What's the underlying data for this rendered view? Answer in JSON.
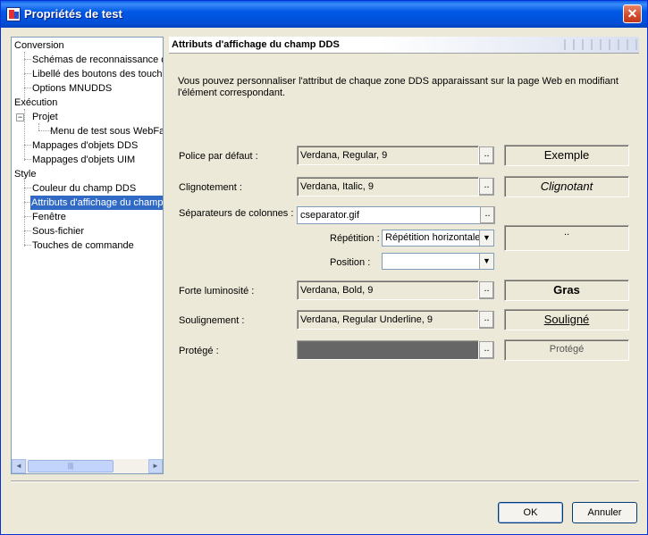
{
  "window": {
    "title": "Propriétés de test",
    "close_label": "✕"
  },
  "tree": {
    "items": [
      {
        "label": "Conversion"
      },
      {
        "label": "Schémas de reconnaissance d"
      },
      {
        "label": "Libellé des boutons des touche"
      },
      {
        "label": "Options MNUDDS"
      },
      {
        "label": "Exécution"
      },
      {
        "label": "Projet"
      },
      {
        "label": "Menu de test sous WebFac"
      },
      {
        "label": "Mappages d'objets DDS"
      },
      {
        "label": "Mappages d'objets UIM"
      },
      {
        "label": "Style"
      },
      {
        "label": "Couleur du champ DDS"
      },
      {
        "label": "Attributs d'affichage du champ"
      },
      {
        "label": "Fenêtre"
      },
      {
        "label": "Sous-fichier"
      },
      {
        "label": "Touches de commande"
      }
    ],
    "expander_label": "−",
    "scroll_left": "◄",
    "scroll_right": "►",
    "scroll_grip": "|||"
  },
  "panel": {
    "title": "Attributs d'affichage du champ DDS",
    "description": "Vous pouvez personnaliser l'attribut de chaque zone DDS apparaissant sur la page Web en modifiant l'élément correspondant."
  },
  "rows": {
    "default_font": {
      "label": "Police par défaut :",
      "value": "Verdana, Regular, 9",
      "sample": "Exemple"
    },
    "blink": {
      "label": "Clignotement :",
      "value": "Verdana, Italic, 9",
      "sample": "Clignotant"
    },
    "separators": {
      "label": "Séparateurs de colonnes :",
      "value": "cseparator.gif",
      "repetition_label": "Répétition :",
      "repetition_value": "Répétition horizontale",
      "position_label": "Position :",
      "position_value": "",
      "preview": ".."
    },
    "highlight": {
      "label": "Forte luminosité :",
      "value": "Verdana, Bold, 9",
      "sample": "Gras"
    },
    "underline": {
      "label": "Soulignement :",
      "value": "Verdana, Regular Underline, 9",
      "sample": "Souligné"
    },
    "protected": {
      "label": "Protégé :",
      "value": "",
      "sample": "Protégé",
      "swatch_color": "#666666"
    }
  },
  "ellipsis": "..",
  "dropdown_arrow": "▼",
  "buttons": {
    "ok": "OK",
    "cancel": "Annuler"
  }
}
